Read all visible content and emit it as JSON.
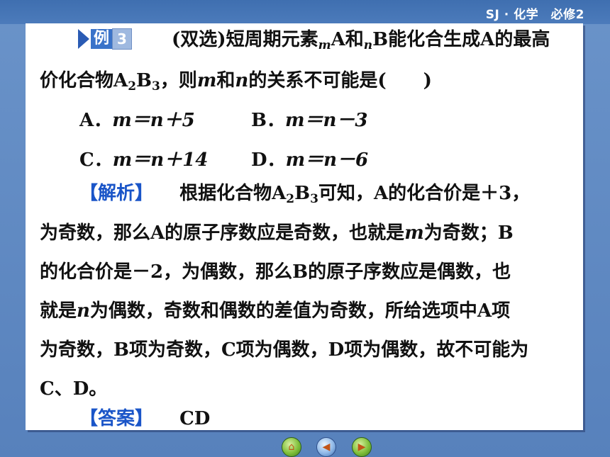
{
  "header": {
    "label": "SJ · 化学　必修2"
  },
  "example": {
    "tag_word": "例",
    "tag_number": "3",
    "question_line1": {
      "pre": "(双选)短周期元素",
      "m": "m",
      "a": "A和",
      "n": "n",
      "rest": "B能化合生成A的最高"
    },
    "question_line2": {
      "pre": "价化合物A",
      "s1": "2",
      "mid": "B",
      "s2": "3",
      "post1": "，则",
      "m": "m",
      "and": "和",
      "n": "n",
      "post2": "的关系不可能是(　　)"
    },
    "options": [
      {
        "letter": "A．",
        "expr": "m＝n＋5"
      },
      {
        "letter": "B．",
        "expr": "m＝n－3"
      },
      {
        "letter": "C．",
        "expr": "m＝n＋14"
      },
      {
        "letter": "D．",
        "expr": "m＝n－6"
      }
    ]
  },
  "analysis": {
    "label": "【解析】",
    "line1": {
      "pre": "根据化合物A",
      "s1": "2",
      "mid": "B",
      "s2": "3",
      "post": "可知，A的化合价是＋3，"
    },
    "line2": {
      "pre": "为奇数，那么A的原子序数应是奇数，也就是",
      "m": "m",
      "post": "为奇数；B"
    },
    "line3": "的化合价是－2，为偶数，那么B的原子序数应是偶数，也",
    "line4": {
      "pre": "就是",
      "n": "n",
      "post": "为偶数，奇数和偶数的差值为奇数，所给选项中A项"
    },
    "line5": "为奇数，B项为奇数，C项为偶数，D项为偶数，故不可能为",
    "line6": "C、D。"
  },
  "answer": {
    "label": "【答案】",
    "value": "CD"
  },
  "nav_buttons": [
    "home-icon",
    "back-icon",
    "forward-icon"
  ]
}
